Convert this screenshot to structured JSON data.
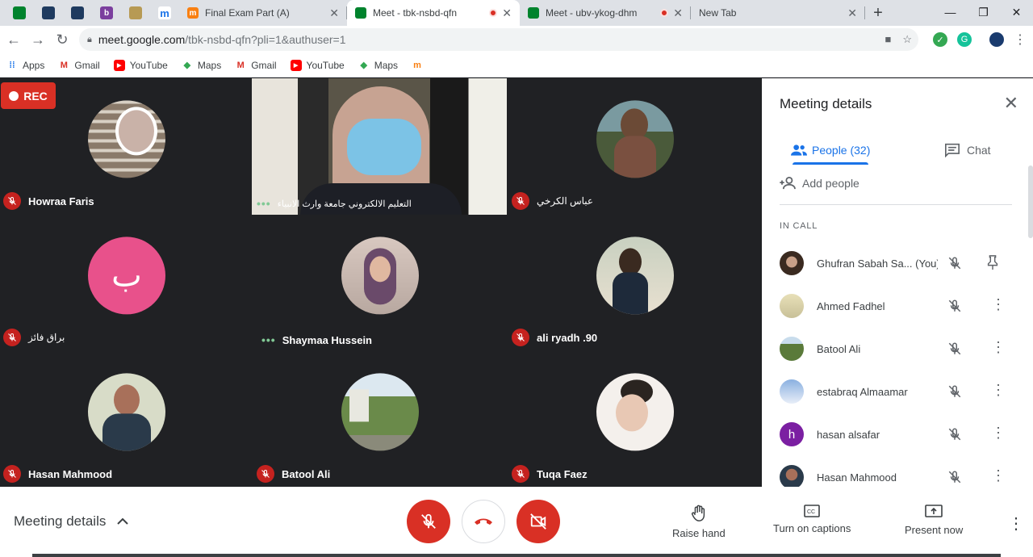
{
  "browser": {
    "tabs": [
      {
        "title": "Final Exam Part (A)",
        "active": false
      },
      {
        "title": "Meet - tbk-nsbd-qfn",
        "active": true,
        "recording": true
      },
      {
        "title": "Meet - ubv-ykog-dhm",
        "active": false,
        "recording": true
      },
      {
        "title": "New Tab",
        "active": false
      }
    ],
    "address": {
      "host": "meet.google.com",
      "path": "/tbk-nsbd-qfn?pli=1&authuser=1"
    },
    "bookmarks": [
      "Apps",
      "Gmail",
      "YouTube",
      "Maps",
      "Gmail",
      "YouTube",
      "Maps"
    ]
  },
  "meet": {
    "rec_label": "REC",
    "tiles": [
      {
        "name": "Howraa Faris",
        "muted": true
      },
      {
        "name": "التعليم الالكتروني جامعة وارث الانبياء",
        "muted": false,
        "speaking": true,
        "video": true
      },
      {
        "name": "عباس الكرخي",
        "muted": true
      },
      {
        "name": "براق فائز",
        "muted": true,
        "initial": "ب"
      },
      {
        "name": "Shaymaa Hussein",
        "muted": false,
        "speaking": true
      },
      {
        "name": "ali ryadh .90",
        "muted": true
      },
      {
        "name": "Hasan Mahmood",
        "muted": true
      },
      {
        "name": "Batool Ali",
        "muted": true
      },
      {
        "name": "Tuqa Faez",
        "muted": true
      }
    ],
    "colors": {
      "muted": "#c5221f",
      "accent": "#1a73e8",
      "initial_avatar": "#e8518b"
    }
  },
  "panel": {
    "title": "Meeting details",
    "tab_people": "People (32)",
    "tab_chat": "Chat",
    "add_people": "Add people",
    "in_call": "IN CALL",
    "people": [
      {
        "name": "Ghufran Sabah Sa... (You)",
        "action": "pin-icon"
      },
      {
        "name": "Ahmed Fadhel",
        "action": "more-icon"
      },
      {
        "name": "Batool Ali",
        "action": "more-icon"
      },
      {
        "name": "estabraq Almaamar",
        "action": "more-icon"
      },
      {
        "name": "hasan alsafar",
        "action": "more-icon",
        "initial": "h"
      },
      {
        "name": "Hasan Mahmood",
        "action": "more-icon"
      }
    ]
  },
  "bottombar": {
    "details": "Meeting details",
    "raise_hand": "Raise hand",
    "captions": "Turn on captions",
    "present": "Present now"
  }
}
